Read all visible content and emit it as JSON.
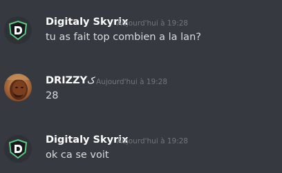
{
  "colors": {
    "background": "#36393f",
    "username": "#ffffff",
    "message_text": "#dcddde",
    "timestamp": "#72767d"
  },
  "messages": [
    {
      "author": "Digitaly Skyrix",
      "author_suffix": "",
      "timestamp": "Aujourd'hui à 19:28",
      "text": "tu as fait top combien a la lan?",
      "avatar_icon": "shield-logo-icon"
    },
    {
      "author": "DRIZZY",
      "author_suffix": "ک",
      "timestamp": "Aujourd'hui à 19:28",
      "text": "28",
      "avatar_icon": "face-photo-icon"
    },
    {
      "author": "Digitaly Skyrix",
      "author_suffix": "",
      "timestamp": "Aujourd'hui à 19:28",
      "text": "ok ca se voit",
      "avatar_icon": "shield-logo-icon"
    }
  ]
}
